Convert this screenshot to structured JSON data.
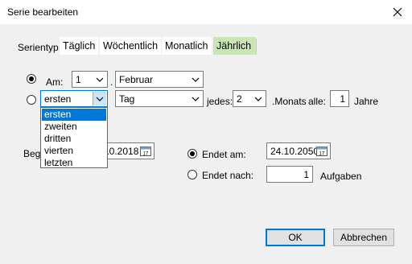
{
  "window": {
    "title": "Serie bearbeiten",
    "close_icon": "close-icon"
  },
  "tabs": {
    "label": "Serientyp:",
    "items": [
      {
        "label": "Täglich"
      },
      {
        "label": "Wöchentlich"
      },
      {
        "label": "Monatlich"
      },
      {
        "label": "Jährlich",
        "active": true
      }
    ]
  },
  "row1": {
    "am_label": "Am:",
    "day": "1",
    "dot": ".",
    "month": "Februar",
    "selected": true
  },
  "row2": {
    "ordinal": "ersten",
    "weekday": "Tag",
    "jedes_label": "jedes:",
    "interval": "2",
    "monats_label": ".Monats",
    "alle_label": "alle:",
    "years": "1",
    "jahre_label": "Jahre",
    "selected": false
  },
  "dropdown": {
    "options": [
      "ersten",
      "zweiten",
      "dritten",
      "vierten",
      "letzten"
    ],
    "selected_index": 0
  },
  "range": {
    "begin_label": "Begi",
    "begin_date": "10.2018",
    "endet_am_label": "Endet am:",
    "end_date": "24.10.2050",
    "endet_nach_label": "Endet nach:",
    "count": "1",
    "aufgaben_label": "Aufgaben",
    "endet_am_selected": true
  },
  "buttons": {
    "ok": "OK",
    "cancel": "Abbrechen"
  },
  "colors": {
    "active_tab": "#c9e6b5",
    "selection": "#0078d7"
  }
}
